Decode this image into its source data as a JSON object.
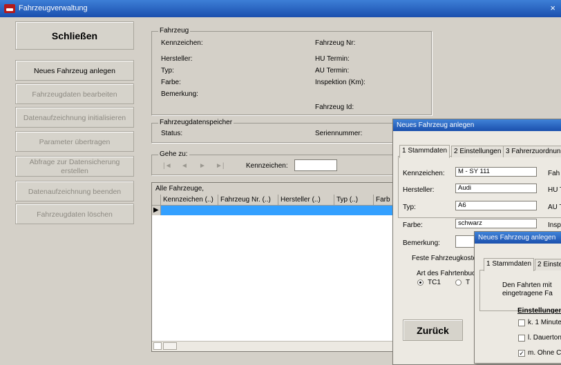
{
  "window": {
    "title": "Fahrzeugverwaltung",
    "close": "×"
  },
  "buttons": {
    "close": "Schließen",
    "new_vehicle": "Neues Fahrzeug anlegen",
    "edit_vehicle": "Fahrzeugdaten bearbeiten",
    "init_recording": "Datenaufzeichnung initialisieren",
    "transfer_params": "Parameter übertragen",
    "query_backup": "Abfrage zur Datensicherung erstellen",
    "end_recording": "Datenaufzeichnung beenden",
    "delete_vehicle": "Fahrzeugdaten löschen"
  },
  "fahrzeug": {
    "title": "Fahrzeug",
    "kennzeichen": "Kennzeichen:",
    "fahrzeug_nr": "Fahrzeug Nr:",
    "hersteller": "Hersteller:",
    "hu_termin": "HU Termin:",
    "typ": "Typ:",
    "au_termin": "AU Termin:",
    "farbe": "Farbe:",
    "inspektion": "Inspektion (Km):",
    "bemerkung": "Bemerkung:",
    "fahrzeug_id": "Fahrzeug Id:"
  },
  "speicher": {
    "title": "Fahrzeugdatenspeicher",
    "status": "Status:",
    "seriennummer": "Seriennummer:"
  },
  "goto": {
    "title": "Gehe zu:",
    "first": "|◄",
    "prev": "◄",
    "next": "►",
    "last": "►|",
    "kennzeichen": "Kennzeichen:"
  },
  "grid": {
    "title": "Alle Fahrzeuge,",
    "columns": [
      "Kennzeichen (..)",
      "Fahrzeug Nr. (..)",
      "Hersteller (..)",
      "Typ (..)",
      "Farb"
    ],
    "row_marker": "▶"
  },
  "dialog1": {
    "title": "Neues Fahrzeug anlegen",
    "tabs": [
      "1 Stammdaten",
      "2 Einstellungen",
      "3 Fahrerzuordnun"
    ],
    "labels": {
      "kennzeichen": "Kennzeichen:",
      "hersteller": "Hersteller:",
      "typ": "Typ:",
      "farbe": "Farbe:",
      "bemerkung": "Bemerkung:"
    },
    "values": {
      "kennzeichen": "M - SY 111",
      "hersteller": "Audi",
      "typ": "A6",
      "farbe": "schwarz"
    },
    "right_labels": [
      "Fah",
      "HU T",
      "AU T",
      "Insp"
    ],
    "feste": "Feste Fahrzeugkoste",
    "art": "Art des Fahrtenbuc",
    "radio1": "TC1",
    "radio2": "T",
    "back": "Zurück"
  },
  "dialog2": {
    "title": "Neues Fahrzeug anlegen",
    "tabs": [
      "1 Stammdaten",
      "2 Einste"
    ],
    "info_line1": "Den Fahrten mit",
    "info_line2": "eingetragene Fa",
    "section": "Einstellungen",
    "options": [
      "k. 1 Minute",
      "l. Dauerton",
      "m. Ohne C"
    ]
  }
}
